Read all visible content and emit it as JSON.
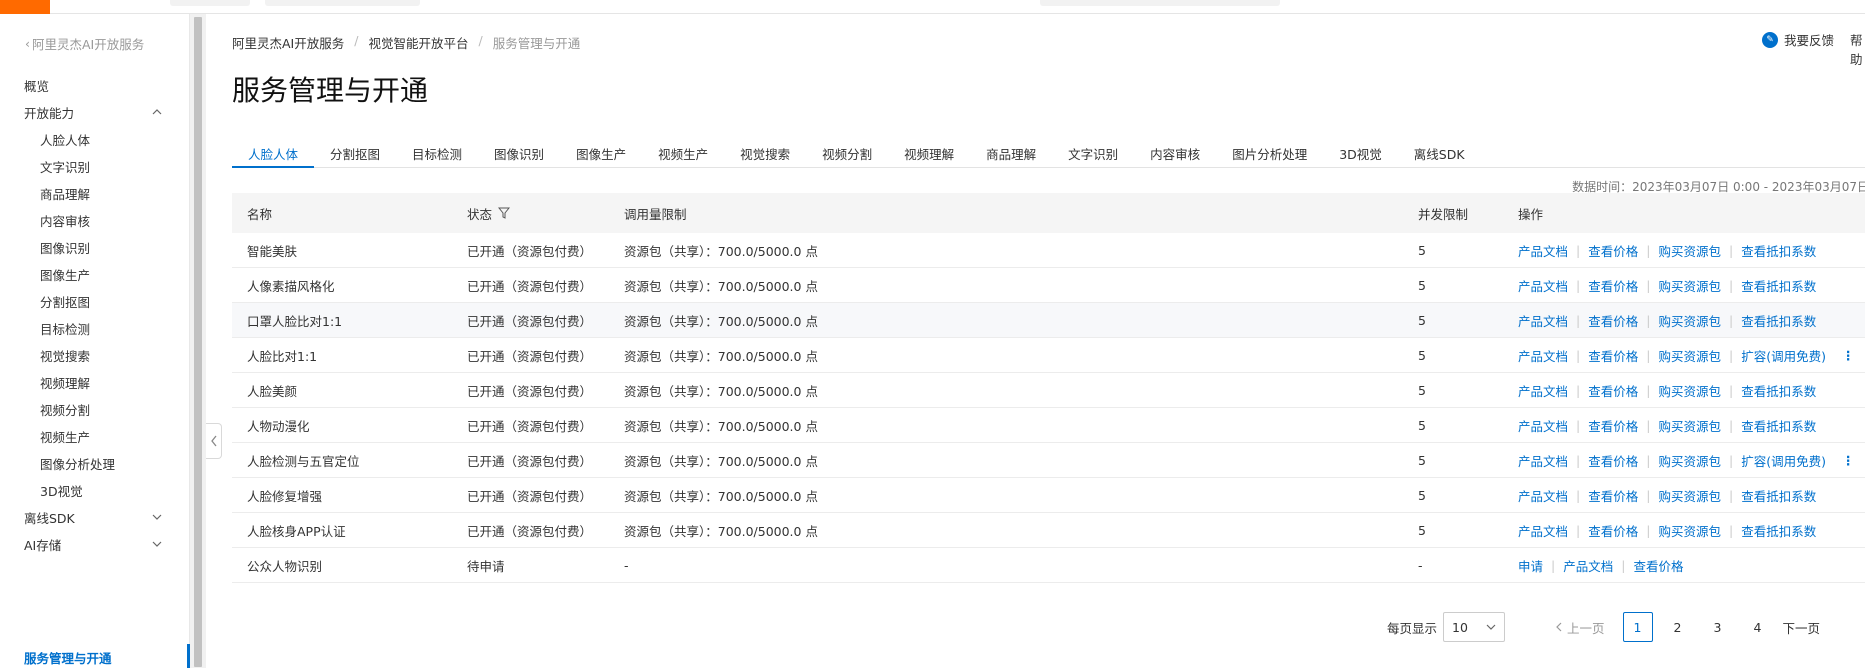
{
  "sidebar": {
    "back_label": "阿里灵杰AI开放服务",
    "items": [
      {
        "label": "概览"
      },
      {
        "label": "开放能力"
      }
    ],
    "sub_items": [
      {
        "label": "人脸人体"
      },
      {
        "label": "文字识别"
      },
      {
        "label": "商品理解"
      },
      {
        "label": "内容审核"
      },
      {
        "label": "图像识别"
      },
      {
        "label": "图像生产"
      },
      {
        "label": "分割抠图"
      },
      {
        "label": "目标检测"
      },
      {
        "label": "视觉搜索"
      },
      {
        "label": "视频理解"
      },
      {
        "label": "视频分割"
      },
      {
        "label": "视频生产"
      },
      {
        "label": "图像分析处理"
      },
      {
        "label": "3D视觉"
      }
    ],
    "bottom_items": [
      {
        "label": "离线SDK"
      },
      {
        "label": "AI存储"
      },
      {
        "label": "服务管理与开通"
      }
    ]
  },
  "breadcrumb": [
    "阿里灵杰AI开放服务",
    "视觉智能开放平台",
    "服务管理与开通"
  ],
  "header": {
    "feedback_label": "我要反馈",
    "help_label": "帮助"
  },
  "page_title": "服务管理与开通",
  "tabs": [
    "人脸人体",
    "分割抠图",
    "目标检测",
    "图像识别",
    "图像生产",
    "视频生产",
    "视觉搜索",
    "视频分割",
    "视频理解",
    "商品理解",
    "文字识别",
    "内容审核",
    "图片分析处理",
    "3D视觉",
    "离线SDK"
  ],
  "data_time": "数据时间：2023年03月07日 0:00 - 2023年03月07日",
  "table": {
    "headers": {
      "name": "名称",
      "status": "状态",
      "limit": "调用量限制",
      "concurrency": "并发限制",
      "ops": "操作"
    },
    "rows": [
      {
        "name": "智能美肤",
        "status": "已开通（资源包付费）",
        "limit": "资源包（共享）：700.0/5000.0 点",
        "conc": "5",
        "ops": [
          "产品文档",
          "查看价格",
          "购买资源包",
          "查看抵扣系数"
        ]
      },
      {
        "name": "人像素描风格化",
        "status": "已开通（资源包付费）",
        "limit": "资源包（共享）：700.0/5000.0 点",
        "conc": "5",
        "ops": [
          "产品文档",
          "查看价格",
          "购买资源包",
          "查看抵扣系数"
        ]
      },
      {
        "name": "口罩人脸比对1:1",
        "status": "已开通（资源包付费）",
        "limit": "资源包（共享）：700.0/5000.0 点",
        "conc": "5",
        "ops": [
          "产品文档",
          "查看价格",
          "购买资源包",
          "查看抵扣系数"
        ]
      },
      {
        "name": "人脸比对1:1",
        "status": "已开通（资源包付费）",
        "limit": "资源包（共享）：700.0/5000.0 点",
        "conc": "5",
        "ops": [
          "产品文档",
          "查看价格",
          "购买资源包",
          "扩容(调用免费)"
        ]
      },
      {
        "name": "人脸美颜",
        "status": "已开通（资源包付费）",
        "limit": "资源包（共享）：700.0/5000.0 点",
        "conc": "5",
        "ops": [
          "产品文档",
          "查看价格",
          "购买资源包",
          "查看抵扣系数"
        ]
      },
      {
        "name": "人物动漫化",
        "status": "已开通（资源包付费）",
        "limit": "资源包（共享）：700.0/5000.0 点",
        "conc": "5",
        "ops": [
          "产品文档",
          "查看价格",
          "购买资源包",
          "查看抵扣系数"
        ]
      },
      {
        "name": "人脸检测与五官定位",
        "status": "已开通（资源包付费）",
        "limit": "资源包（共享）：700.0/5000.0 点",
        "conc": "5",
        "ops": [
          "产品文档",
          "查看价格",
          "购买资源包",
          "扩容(调用免费)"
        ]
      },
      {
        "name": "人脸修复增强",
        "status": "已开通（资源包付费）",
        "limit": "资源包（共享）：700.0/5000.0 点",
        "conc": "5",
        "ops": [
          "产品文档",
          "查看价格",
          "购买资源包",
          "查看抵扣系数"
        ]
      },
      {
        "name": "人脸核身APP认证",
        "status": "已开通（资源包付费）",
        "limit": "资源包（共享）：700.0/5000.0 点",
        "conc": "5",
        "ops": [
          "产品文档",
          "查看价格",
          "购买资源包",
          "查看抵扣系数"
        ]
      },
      {
        "name": "公众人物识别",
        "status": "待申请",
        "limit": "-",
        "conc": "-",
        "ops": [
          "申请",
          "产品文档",
          "查看价格"
        ]
      }
    ]
  },
  "pager": {
    "page_size_label": "每页显示",
    "page_size": "10",
    "prev_label": "上一页",
    "pages": [
      "1",
      "2",
      "3",
      "4"
    ],
    "current": "1",
    "next_label": "下一页"
  },
  "colors": {
    "accent": "#0070cc",
    "brand": "#ff6a00"
  }
}
